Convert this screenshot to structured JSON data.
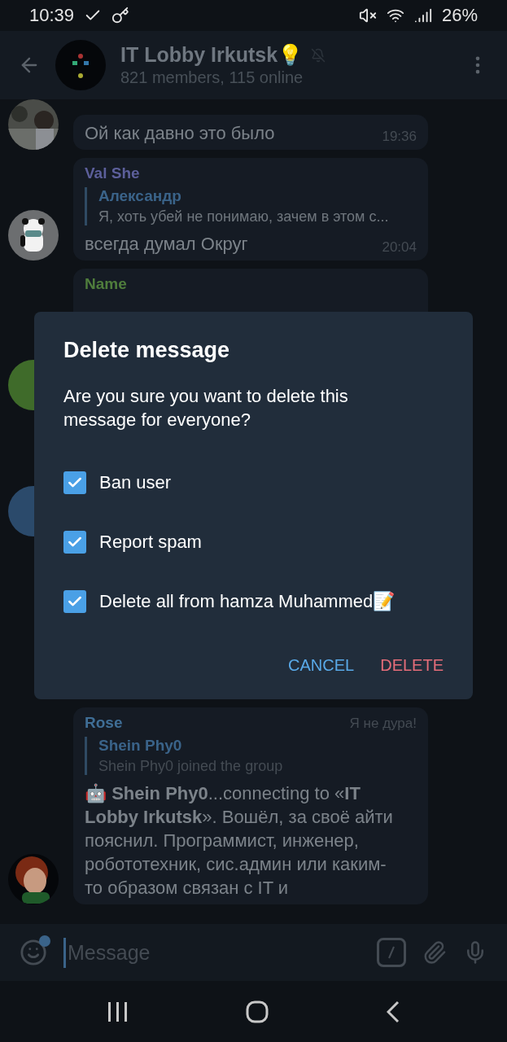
{
  "status_bar": {
    "time": "10:39",
    "battery": "26%"
  },
  "header": {
    "title": "IT Lobby Irkutsk💡",
    "muted": true,
    "subtitle": "821 members, 115 online"
  },
  "messages": [
    {
      "text": "Ой как давно это было",
      "time": "19:36"
    },
    {
      "avatar": {
        "kind": "panda"
      },
      "sender": "Val She",
      "color": "#5c5f9a",
      "reply": {
        "author": "Александр",
        "text": "Я, хоть убей не понимаю, зачем в этом с..."
      },
      "text": "всегда думал Округ",
      "time": "20:04"
    },
    {
      "avatar": {
        "kind": "letter",
        "color": "#3f6b2a"
      },
      "sender": "Name",
      "color": "#4f7d3c"
    },
    {
      "avatar": {
        "kind": "letter",
        "color": "#2b4a6b"
      }
    },
    {
      "avatar": {
        "kind": "cartoon"
      },
      "sender": "Rose",
      "color": "#3f6e96",
      "title": "Я не дура!",
      "reply": {
        "author": "Shein Phy0",
        "text": "Shein Phy0 joined the group"
      },
      "text": "🤖 **Shein Phy0**...connecting to «**IT Lobby Irkutsk**». Вошёл, за своё айти пояснил. Программист, инженер, робототехник, сис.админ или каким-то образом связан с IT и"
    }
  ],
  "input": {
    "placeholder": "Message"
  },
  "dialog": {
    "title": "Delete message",
    "text": "Are you sure you want to delete this message for everyone?",
    "options": [
      {
        "label": "Ban user",
        "checked": true
      },
      {
        "label": "Report spam",
        "checked": true
      },
      {
        "label": "Delete all from hamza Muhammed📝",
        "checked": true
      }
    ],
    "buttons": [
      {
        "label": "CANCEL",
        "kind": "neutral"
      },
      {
        "label": "DELETE",
        "kind": "danger"
      }
    ]
  }
}
